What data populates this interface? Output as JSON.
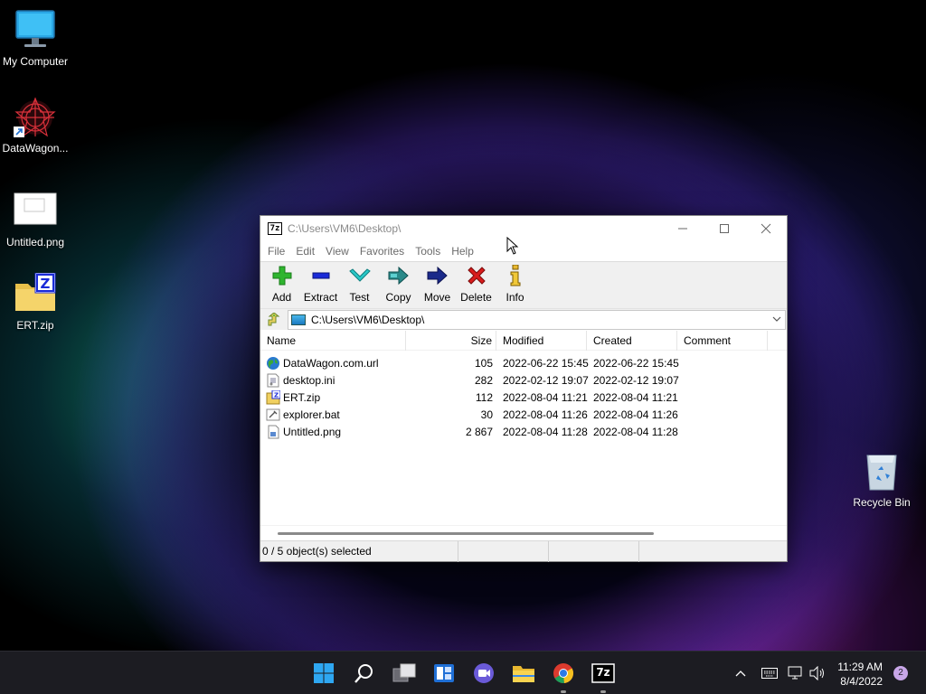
{
  "desktop": {
    "icons": [
      {
        "label": "My Computer"
      },
      {
        "label": "DataWagon..."
      },
      {
        "label": "Untitled.png"
      },
      {
        "label": "ERT.zip"
      },
      {
        "label": "Recycle Bin"
      }
    ]
  },
  "window": {
    "app_icon_text": "7z",
    "title": "C:\\Users\\VM6\\Desktop\\",
    "menu": [
      "File",
      "Edit",
      "View",
      "Favorites",
      "Tools",
      "Help"
    ],
    "toolbar": [
      {
        "label": "Add",
        "icon": "plus-icon"
      },
      {
        "label": "Extract",
        "icon": "minus-icon"
      },
      {
        "label": "Test",
        "icon": "check-icon"
      },
      {
        "label": "Copy",
        "icon": "copy-arrow-icon"
      },
      {
        "label": "Move",
        "icon": "move-arrow-icon"
      },
      {
        "label": "Delete",
        "icon": "delete-x-icon"
      },
      {
        "label": "Info",
        "icon": "info-icon"
      }
    ],
    "address": "C:\\Users\\VM6\\Desktop\\",
    "columns": [
      "Name",
      "Size",
      "Modified",
      "Created",
      "Comment"
    ],
    "files": [
      {
        "name": "DataWagon.com.url",
        "size": "105",
        "modified": "2022-06-22 15:45",
        "created": "2022-06-22 15:45",
        "comment": "",
        "icon": "globe-icon"
      },
      {
        "name": "desktop.ini",
        "size": "282",
        "modified": "2022-02-12 19:07",
        "created": "2022-02-12 19:07",
        "comment": "",
        "icon": "ini-file-icon"
      },
      {
        "name": "ERT.zip",
        "size": "112",
        "modified": "2022-08-04 11:21",
        "created": "2022-08-04 11:21",
        "comment": "",
        "icon": "zip-file-icon"
      },
      {
        "name": "explorer.bat",
        "size": "30",
        "modified": "2022-08-04 11:26",
        "created": "2022-08-04 11:26",
        "comment": "",
        "icon": "bat-file-icon"
      },
      {
        "name": "Untitled.png",
        "size": "2 867",
        "modified": "2022-08-04 11:28",
        "created": "2022-08-04 11:28",
        "comment": "",
        "icon": "image-file-icon"
      }
    ],
    "status": "0 / 5 object(s) selected"
  },
  "taskbar": {
    "time": "11:29 AM",
    "date": "8/4/2022",
    "notification_count": "2",
    "pinned_7z_text": "7z"
  },
  "colors": {
    "taskbar_bg": "#1c1c22",
    "toolbar_bg": "#f0f0f0",
    "add_green": "#2fb52f",
    "extract_blue": "#1a2ad8",
    "delete_red": "#d81c1c"
  }
}
